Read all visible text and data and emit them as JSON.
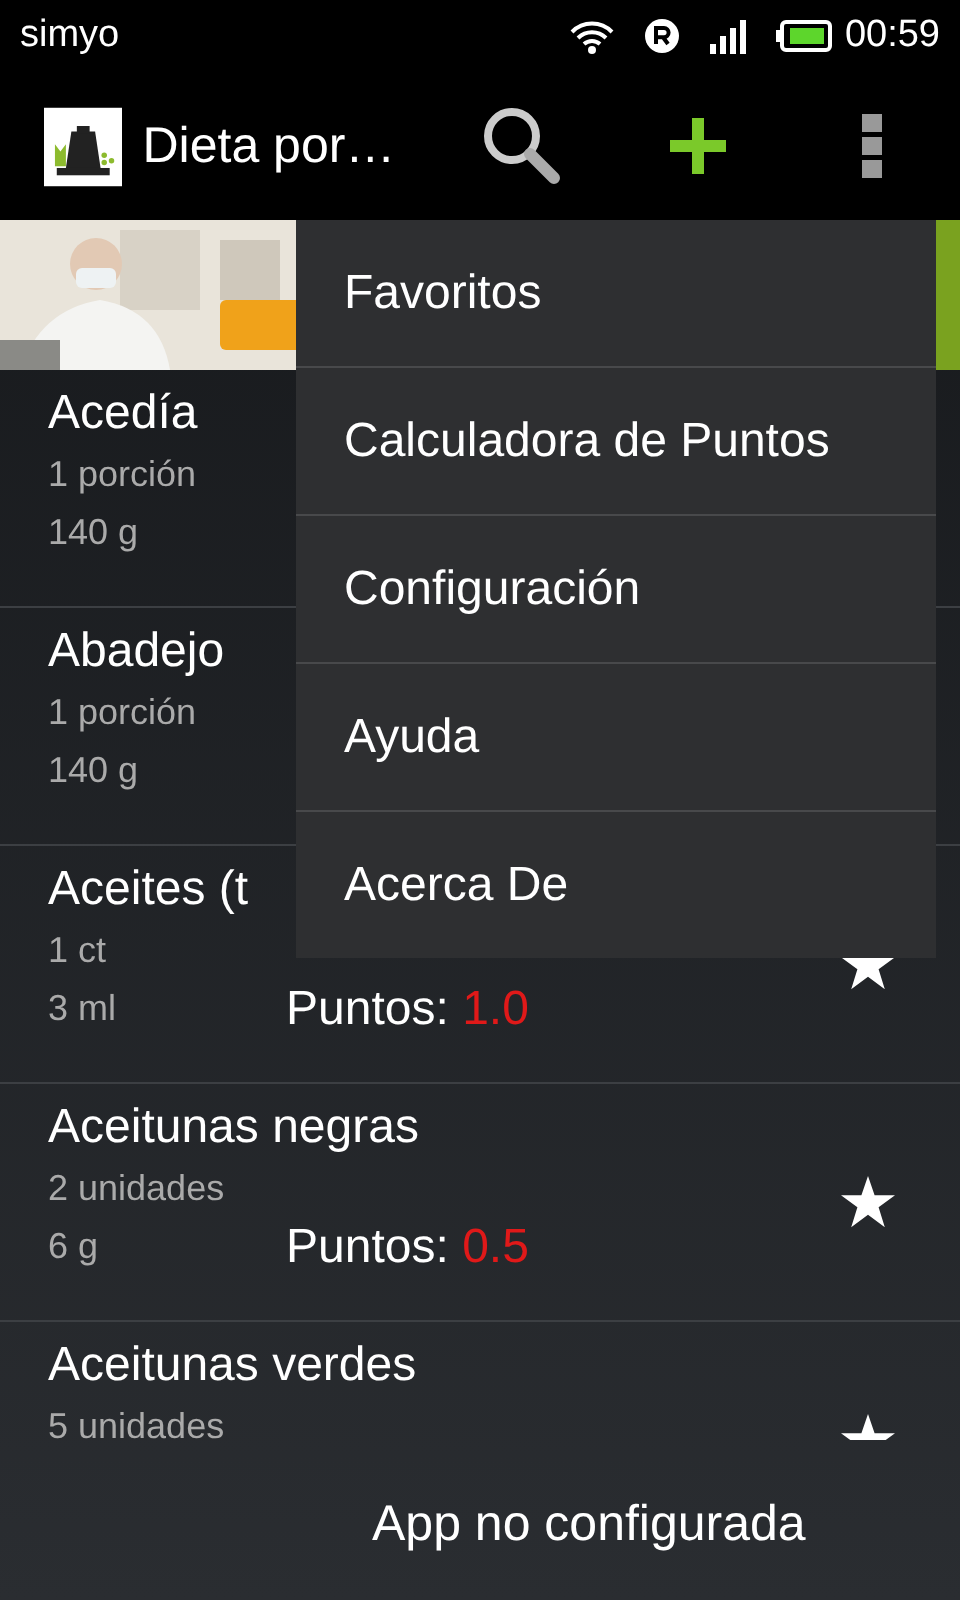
{
  "status_bar": {
    "carrier": "simyo",
    "time": "00:59"
  },
  "action_bar": {
    "title": "Dieta por…"
  },
  "foods": [
    {
      "name": "Acedía",
      "portion": "1 porción",
      "weight": "140 g",
      "show_star": false
    },
    {
      "name": "Abadejo",
      "portion": "1 porción",
      "weight": "140 g",
      "show_star": false
    },
    {
      "name": "Aceites (t",
      "portion": "1 ct",
      "weight": "3 ml",
      "points_label": "Puntos:",
      "points": "1.0",
      "show_star": true
    },
    {
      "name": "Aceitunas negras",
      "portion": "2 unidades",
      "weight": "6 g",
      "points_label": "Puntos:",
      "points": "0.5",
      "show_star": true
    },
    {
      "name": "Aceitunas verdes",
      "portion": "5 unidades",
      "show_star": true
    }
  ],
  "menu": {
    "items": [
      {
        "label": "Favoritos"
      },
      {
        "label": "Calculadora de Puntos"
      },
      {
        "label": "Configuración"
      },
      {
        "label": "Ayuda"
      },
      {
        "label": "Acerca De"
      }
    ]
  },
  "toast": {
    "message": "App no configurada"
  }
}
